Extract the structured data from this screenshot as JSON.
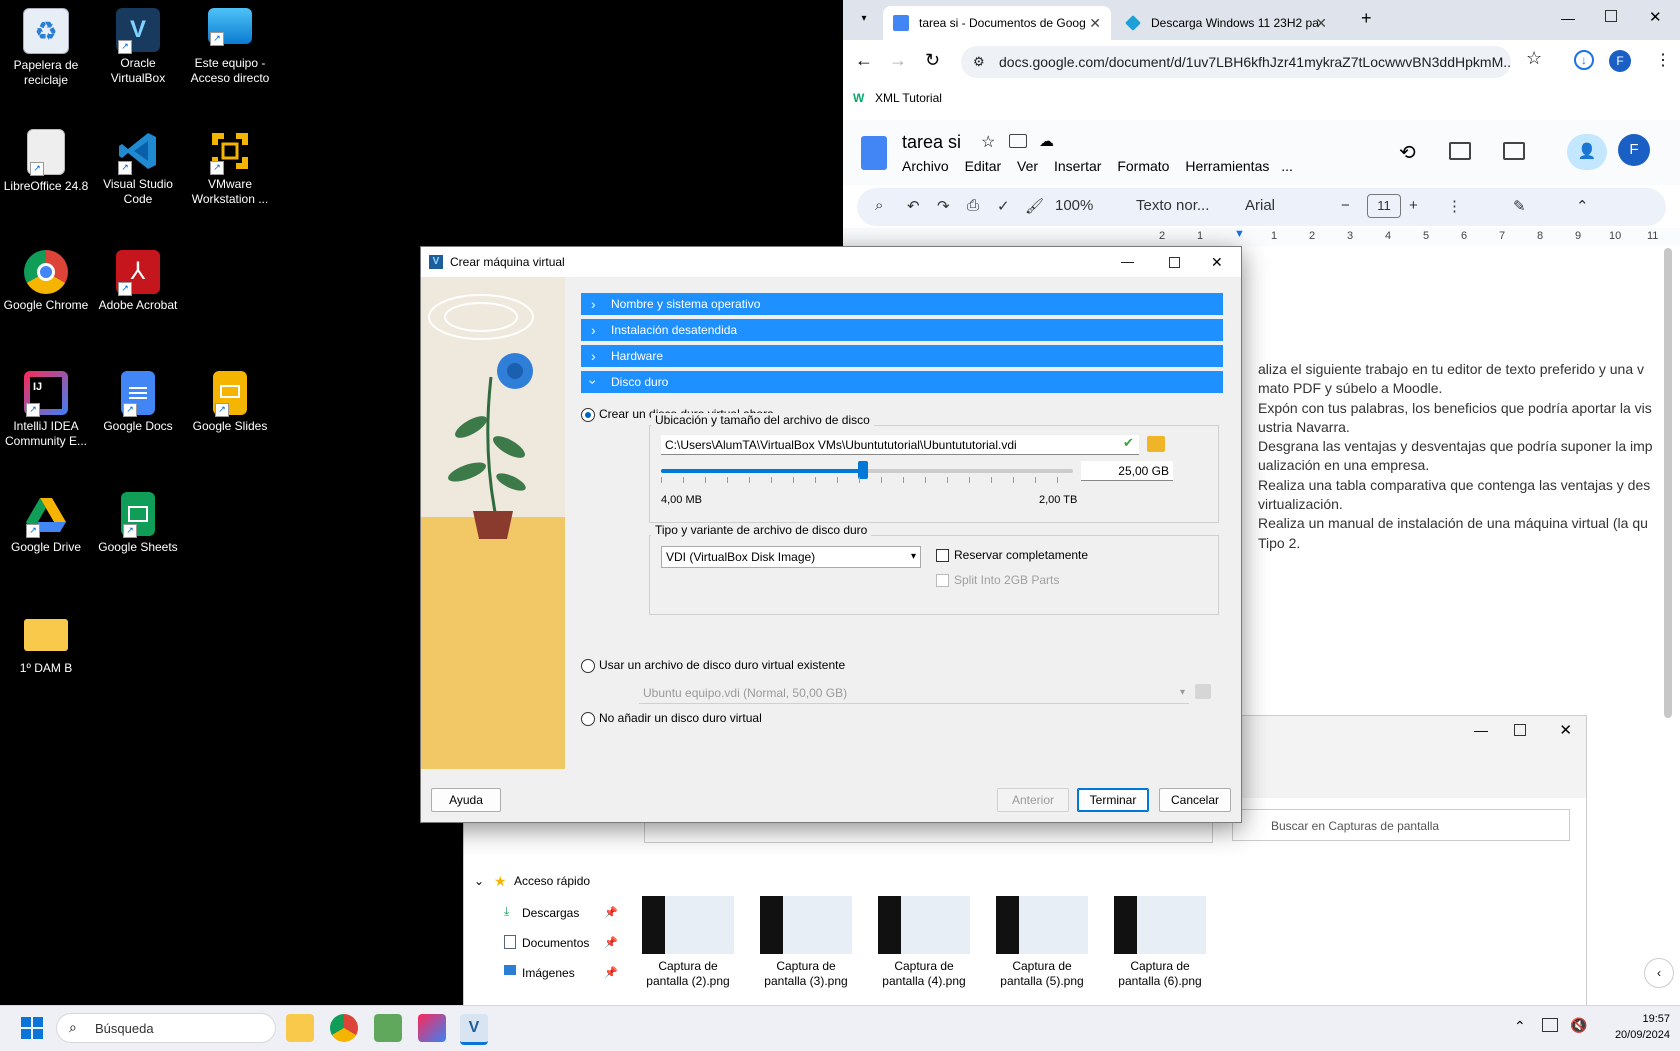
{
  "desktop": {
    "icons": [
      {
        "label": "Papelera de reciclaje",
        "icon": "recycle-bin-icon"
      },
      {
        "label": "Oracle VirtualBox",
        "icon": "virtualbox-icon"
      },
      {
        "label": "Este equipo - Acceso directo",
        "icon": "this-pc-icon"
      },
      {
        "label": "LibreOffice 24.8",
        "icon": "libreoffice-icon"
      },
      {
        "label": "Visual Studio Code",
        "icon": "vscode-icon"
      },
      {
        "label": "VMware Workstation ...",
        "icon": "vmware-icon"
      },
      {
        "label": "Google Chrome",
        "icon": "chrome-icon"
      },
      {
        "label": "Adobe Acrobat",
        "icon": "acrobat-icon"
      },
      {
        "label": "IntelliJ IDEA Community E...",
        "icon": "intellij-icon"
      },
      {
        "label": "Google Docs",
        "icon": "google-docs-icon"
      },
      {
        "label": "Google Slides",
        "icon": "google-slides-icon"
      },
      {
        "label": "Google Drive",
        "icon": "google-drive-icon"
      },
      {
        "label": "Google Sheets",
        "icon": "google-sheets-icon"
      },
      {
        "label": "1º DAM B",
        "icon": "folder-icon"
      }
    ]
  },
  "browser": {
    "tabs": [
      {
        "title": "tarea si - Documentos de Goog",
        "active": true
      },
      {
        "title": "Descarga Windows 11 23H2 pa",
        "active": false
      }
    ],
    "url": "docs.google.com/document/d/1uv7LBH6kfhJzr41mykraZ7tLocwwvBN3ddHpkmM...",
    "bookmark": "XML Tutorial",
    "profile_initial": "F"
  },
  "docs": {
    "title": "tarea si",
    "menu": [
      "Archivo",
      "Editar",
      "Ver",
      "Insertar",
      "Formato",
      "Herramientas",
      "..."
    ],
    "zoom": "100%",
    "style": "Texto nor...",
    "font": "Arial",
    "font_size": "11",
    "ruler": [
      "2",
      "1",
      "1",
      "2",
      "3",
      "4",
      "5",
      "6",
      "7",
      "8",
      "9",
      "10",
      "11"
    ],
    "body_lines": [
      "aliza el siguiente trabajo en tu editor de texto preferido y una v",
      "mato PDF y súbelo a Moodle.",
      "Expón con tus palabras, los beneficios que podría aportar la vis",
      "ustria Navarra.",
      "Desgrana las ventajas y desventajas que podría suponer la imp",
      "ualización en una empresa.",
      "Realiza una tabla comparativa que contenga las ventajas y des",
      "virtualización.",
      "Realiza un manual de instalación de una máquina virtual (la qu",
      "Tipo 2."
    ]
  },
  "explorer": {
    "search_placeholder": "Buscar en Capturas de pantalla",
    "quick_access": "Acceso rápido",
    "nav": [
      "Descargas",
      "Documentos",
      "Imágenes"
    ],
    "files": [
      "Captura de pantalla (2).png",
      "Captura de pantalla (3).png",
      "Captura de pantalla (4).png",
      "Captura de pantalla (5).png",
      "Captura de pantalla (6).png"
    ]
  },
  "dialog": {
    "title": "Crear máquina virtual",
    "sections": [
      "Nombre y sistema operativo",
      "Instalación desatendida",
      "Hardware",
      "Disco duro"
    ],
    "opt_create": "Crear un disco duro virtual ahora",
    "location_legend": "Ubicación y tamaño del archivo de disco",
    "path": "C:\\Users\\AlumTA\\VirtualBox VMs\\Ubuntututorial\\Ubuntututorial.vdi",
    "size": "25,00 GB",
    "size_fraction": 0.49,
    "size_min": "4,00 MB",
    "size_max": "2,00 TB",
    "type_legend": "Tipo y variante de archivo de disco duro",
    "disk_type": "VDI (VirtualBox Disk Image)",
    "reserve": "Reservar completamente",
    "split": "Split Into 2GB Parts",
    "opt_existing": "Usar un archivo de disco duro virtual existente",
    "existing_file": "Ubuntu equipo.vdi (Normal, 50,00 GB)",
    "opt_none": "No añadir un disco duro virtual",
    "buttons": {
      "help": "Ayuda",
      "back": "Anterior",
      "finish": "Terminar",
      "cancel": "Cancelar"
    }
  },
  "taskbar": {
    "search": "Búsqueda",
    "time": "19:57",
    "date": "20/09/2024"
  }
}
